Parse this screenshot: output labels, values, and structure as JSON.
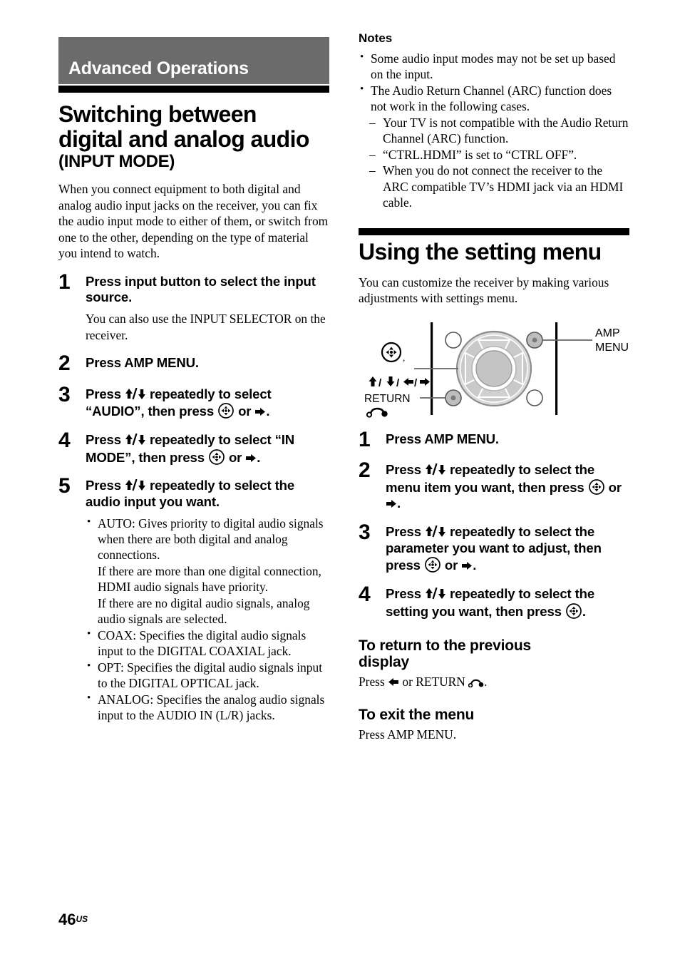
{
  "page": {
    "number": "46",
    "region_suffix": "US",
    "banner_color": "#6b6b6b"
  },
  "left_column": {
    "chapter_banner": "Advanced Operations",
    "section_title_line1": "Switching between",
    "section_title_line2": "digital and analog audio",
    "section_subtitle": "(INPUT MODE)",
    "intro": "When you connect equipment to both digital and analog audio input jacks on the receiver, you can fix the audio input mode to either of them, or switch from one to the other, depending on the type of material you intend to watch.",
    "steps": [
      {
        "num": "1",
        "title": "Press input button to select the input source.",
        "note": "You can also use the INPUT SELECTOR on the receiver."
      },
      {
        "num": "2",
        "title": "Press AMP MENU."
      },
      {
        "num": "3",
        "title_a": "Press ",
        "title_b": " repeatedly to select “AUDIO”, then press ",
        "title_c": " or ",
        "title_d": "."
      },
      {
        "num": "4",
        "title_a": "Press ",
        "title_b": " repeatedly to select “IN MODE”, then press ",
        "title_c": " or ",
        "title_d": "."
      },
      {
        "num": "5",
        "title_a": "Press ",
        "title_b": " repeatedly to select the audio input you want."
      }
    ],
    "mode_bullets": [
      "AUTO: Gives priority to digital audio signals when there are both digital and analog connections.\nIf there are more than one digital connection, HDMI audio signals have priority.\nIf there are no digital audio signals, analog audio signals are selected.",
      "COAX: Specifies the digital audio signals input to the DIGITAL COAXIAL jack.",
      "OPT: Specifies the digital audio signals input to the DIGITAL OPTICAL jack.",
      "ANALOG: Specifies the analog audio signals input to the AUDIO IN (L/R) jacks."
    ]
  },
  "right_column": {
    "notes_heading": "Notes",
    "notes": [
      "Some audio input modes may not be set up based on the input.",
      "The Audio Return Channel (ARC) function does not work in the following cases."
    ],
    "note_subitems": [
      "Your TV is not compatible with the Audio Return Channel (ARC) function.",
      "“CTRL.HDMI” is set to “CTRL OFF”.",
      "When you do not connect the receiver to the ARC compatible TV’s HDMI jack via an HDMI cable."
    ],
    "section_title": "Using the setting menu",
    "intro": "You can customize the receiver by making various adjustments with settings menu.",
    "diagram": {
      "label_amp_menu_line1": "AMP",
      "label_amp_menu_line2": "MENU",
      "label_return": "RETURN",
      "label_nav_arrows": "↑/↓/←/→"
    },
    "steps": [
      {
        "num": "1",
        "title": "Press AMP MENU."
      },
      {
        "num": "2",
        "title_a": "Press ",
        "title_b": " repeatedly to select the menu item you want, then press ",
        "title_c": " or ",
        "title_d": "."
      },
      {
        "num": "3",
        "title_a": "Press ",
        "title_b": " repeatedly to select the parameter you want to adjust, then press ",
        "title_c": " or ",
        "title_d": "."
      },
      {
        "num": "4",
        "title_a": "Press ",
        "title_b": " repeatedly to select the setting you want, then press ",
        "title_c": "."
      }
    ],
    "return_heading_line1": "To return to the previous",
    "return_heading_line2": "display",
    "return_text_a": "Press ",
    "return_text_b": " or RETURN ",
    "return_text_c": ".",
    "exit_heading": "To exit the menu",
    "exit_text": "Press AMP MENU."
  }
}
